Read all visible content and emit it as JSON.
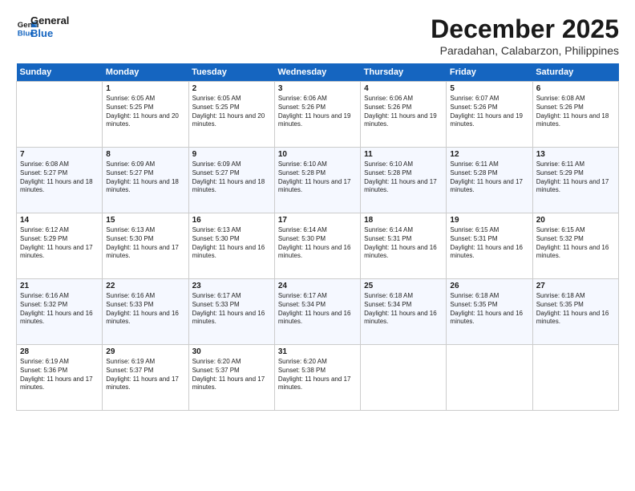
{
  "header": {
    "logo_line1": "General",
    "logo_line2": "Blue",
    "month": "December 2025",
    "location": "Paradahan, Calabarzon, Philippines"
  },
  "days_of_week": [
    "Sunday",
    "Monday",
    "Tuesday",
    "Wednesday",
    "Thursday",
    "Friday",
    "Saturday"
  ],
  "weeks": [
    [
      {
        "day": "",
        "sunrise": "",
        "sunset": "",
        "daylight": ""
      },
      {
        "day": "1",
        "sunrise": "Sunrise: 6:05 AM",
        "sunset": "Sunset: 5:25 PM",
        "daylight": "Daylight: 11 hours and 20 minutes."
      },
      {
        "day": "2",
        "sunrise": "Sunrise: 6:05 AM",
        "sunset": "Sunset: 5:25 PM",
        "daylight": "Daylight: 11 hours and 20 minutes."
      },
      {
        "day": "3",
        "sunrise": "Sunrise: 6:06 AM",
        "sunset": "Sunset: 5:26 PM",
        "daylight": "Daylight: 11 hours and 19 minutes."
      },
      {
        "day": "4",
        "sunrise": "Sunrise: 6:06 AM",
        "sunset": "Sunset: 5:26 PM",
        "daylight": "Daylight: 11 hours and 19 minutes."
      },
      {
        "day": "5",
        "sunrise": "Sunrise: 6:07 AM",
        "sunset": "Sunset: 5:26 PM",
        "daylight": "Daylight: 11 hours and 19 minutes."
      },
      {
        "day": "6",
        "sunrise": "Sunrise: 6:08 AM",
        "sunset": "Sunset: 5:26 PM",
        "daylight": "Daylight: 11 hours and 18 minutes."
      }
    ],
    [
      {
        "day": "7",
        "sunrise": "Sunrise: 6:08 AM",
        "sunset": "Sunset: 5:27 PM",
        "daylight": "Daylight: 11 hours and 18 minutes."
      },
      {
        "day": "8",
        "sunrise": "Sunrise: 6:09 AM",
        "sunset": "Sunset: 5:27 PM",
        "daylight": "Daylight: 11 hours and 18 minutes."
      },
      {
        "day": "9",
        "sunrise": "Sunrise: 6:09 AM",
        "sunset": "Sunset: 5:27 PM",
        "daylight": "Daylight: 11 hours and 18 minutes."
      },
      {
        "day": "10",
        "sunrise": "Sunrise: 6:10 AM",
        "sunset": "Sunset: 5:28 PM",
        "daylight": "Daylight: 11 hours and 17 minutes."
      },
      {
        "day": "11",
        "sunrise": "Sunrise: 6:10 AM",
        "sunset": "Sunset: 5:28 PM",
        "daylight": "Daylight: 11 hours and 17 minutes."
      },
      {
        "day": "12",
        "sunrise": "Sunrise: 6:11 AM",
        "sunset": "Sunset: 5:28 PM",
        "daylight": "Daylight: 11 hours and 17 minutes."
      },
      {
        "day": "13",
        "sunrise": "Sunrise: 6:11 AM",
        "sunset": "Sunset: 5:29 PM",
        "daylight": "Daylight: 11 hours and 17 minutes."
      }
    ],
    [
      {
        "day": "14",
        "sunrise": "Sunrise: 6:12 AM",
        "sunset": "Sunset: 5:29 PM",
        "daylight": "Daylight: 11 hours and 17 minutes."
      },
      {
        "day": "15",
        "sunrise": "Sunrise: 6:13 AM",
        "sunset": "Sunset: 5:30 PM",
        "daylight": "Daylight: 11 hours and 17 minutes."
      },
      {
        "day": "16",
        "sunrise": "Sunrise: 6:13 AM",
        "sunset": "Sunset: 5:30 PM",
        "daylight": "Daylight: 11 hours and 16 minutes."
      },
      {
        "day": "17",
        "sunrise": "Sunrise: 6:14 AM",
        "sunset": "Sunset: 5:30 PM",
        "daylight": "Daylight: 11 hours and 16 minutes."
      },
      {
        "day": "18",
        "sunrise": "Sunrise: 6:14 AM",
        "sunset": "Sunset: 5:31 PM",
        "daylight": "Daylight: 11 hours and 16 minutes."
      },
      {
        "day": "19",
        "sunrise": "Sunrise: 6:15 AM",
        "sunset": "Sunset: 5:31 PM",
        "daylight": "Daylight: 11 hours and 16 minutes."
      },
      {
        "day": "20",
        "sunrise": "Sunrise: 6:15 AM",
        "sunset": "Sunset: 5:32 PM",
        "daylight": "Daylight: 11 hours and 16 minutes."
      }
    ],
    [
      {
        "day": "21",
        "sunrise": "Sunrise: 6:16 AM",
        "sunset": "Sunset: 5:32 PM",
        "daylight": "Daylight: 11 hours and 16 minutes."
      },
      {
        "day": "22",
        "sunrise": "Sunrise: 6:16 AM",
        "sunset": "Sunset: 5:33 PM",
        "daylight": "Daylight: 11 hours and 16 minutes."
      },
      {
        "day": "23",
        "sunrise": "Sunrise: 6:17 AM",
        "sunset": "Sunset: 5:33 PM",
        "daylight": "Daylight: 11 hours and 16 minutes."
      },
      {
        "day": "24",
        "sunrise": "Sunrise: 6:17 AM",
        "sunset": "Sunset: 5:34 PM",
        "daylight": "Daylight: 11 hours and 16 minutes."
      },
      {
        "day": "25",
        "sunrise": "Sunrise: 6:18 AM",
        "sunset": "Sunset: 5:34 PM",
        "daylight": "Daylight: 11 hours and 16 minutes."
      },
      {
        "day": "26",
        "sunrise": "Sunrise: 6:18 AM",
        "sunset": "Sunset: 5:35 PM",
        "daylight": "Daylight: 11 hours and 16 minutes."
      },
      {
        "day": "27",
        "sunrise": "Sunrise: 6:18 AM",
        "sunset": "Sunset: 5:35 PM",
        "daylight": "Daylight: 11 hours and 16 minutes."
      }
    ],
    [
      {
        "day": "28",
        "sunrise": "Sunrise: 6:19 AM",
        "sunset": "Sunset: 5:36 PM",
        "daylight": "Daylight: 11 hours and 17 minutes."
      },
      {
        "day": "29",
        "sunrise": "Sunrise: 6:19 AM",
        "sunset": "Sunset: 5:37 PM",
        "daylight": "Daylight: 11 hours and 17 minutes."
      },
      {
        "day": "30",
        "sunrise": "Sunrise: 6:20 AM",
        "sunset": "Sunset: 5:37 PM",
        "daylight": "Daylight: 11 hours and 17 minutes."
      },
      {
        "day": "31",
        "sunrise": "Sunrise: 6:20 AM",
        "sunset": "Sunset: 5:38 PM",
        "daylight": "Daylight: 11 hours and 17 minutes."
      },
      {
        "day": "",
        "sunrise": "",
        "sunset": "",
        "daylight": ""
      },
      {
        "day": "",
        "sunrise": "",
        "sunset": "",
        "daylight": ""
      },
      {
        "day": "",
        "sunrise": "",
        "sunset": "",
        "daylight": ""
      }
    ]
  ]
}
